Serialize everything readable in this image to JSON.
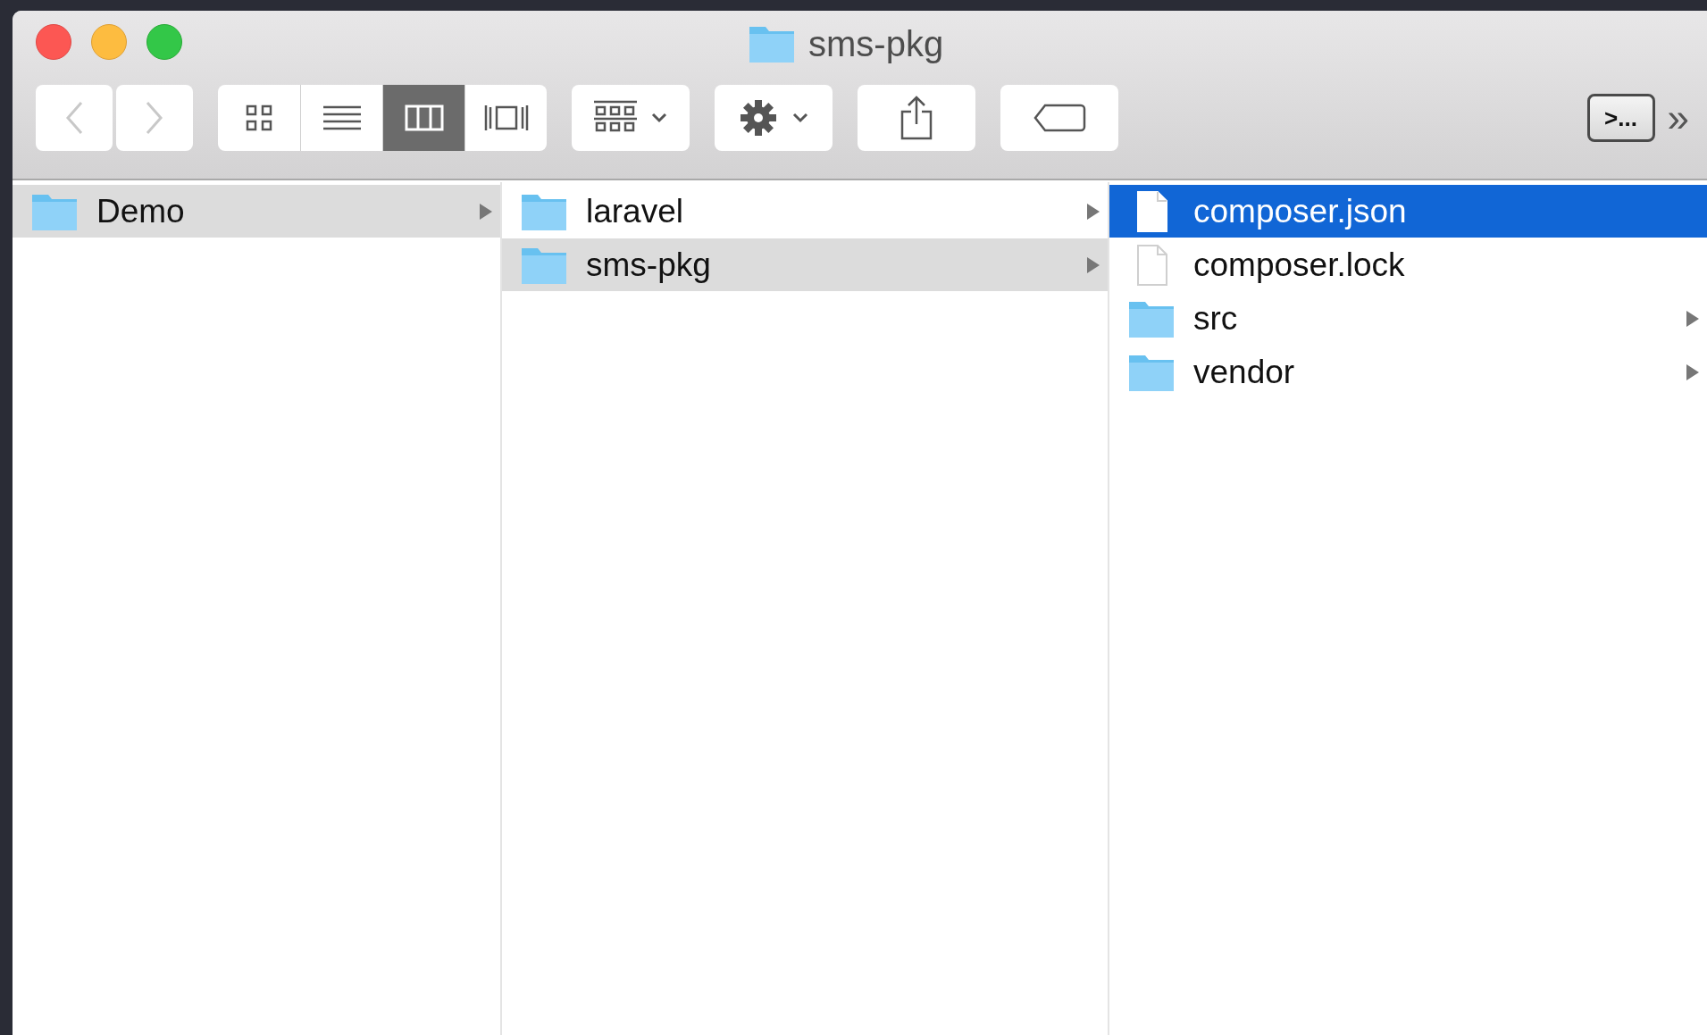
{
  "window": {
    "title": "sms-pkg"
  },
  "toolbar": {
    "view_modes": [
      {
        "kind": "icons",
        "selected": false
      },
      {
        "kind": "list",
        "selected": false
      },
      {
        "kind": "columns",
        "selected": true
      },
      {
        "kind": "coverflow",
        "selected": false
      }
    ],
    "terminal_label": ">...",
    "overflow": "»"
  },
  "columns": [
    {
      "focused": false,
      "items": [
        {
          "name": "Demo",
          "kind": "folder",
          "selected": true
        }
      ]
    },
    {
      "focused": false,
      "items": [
        {
          "name": "laravel",
          "kind": "folder",
          "selected": false
        },
        {
          "name": "sms-pkg",
          "kind": "folder",
          "selected": true
        }
      ]
    },
    {
      "focused": true,
      "items": [
        {
          "name": "composer.json",
          "kind": "file",
          "selected": true
        },
        {
          "name": "composer.lock",
          "kind": "file",
          "selected": false
        },
        {
          "name": "src",
          "kind": "folder",
          "selected": false
        },
        {
          "name": "vendor",
          "kind": "folder",
          "selected": false
        }
      ]
    }
  ]
}
